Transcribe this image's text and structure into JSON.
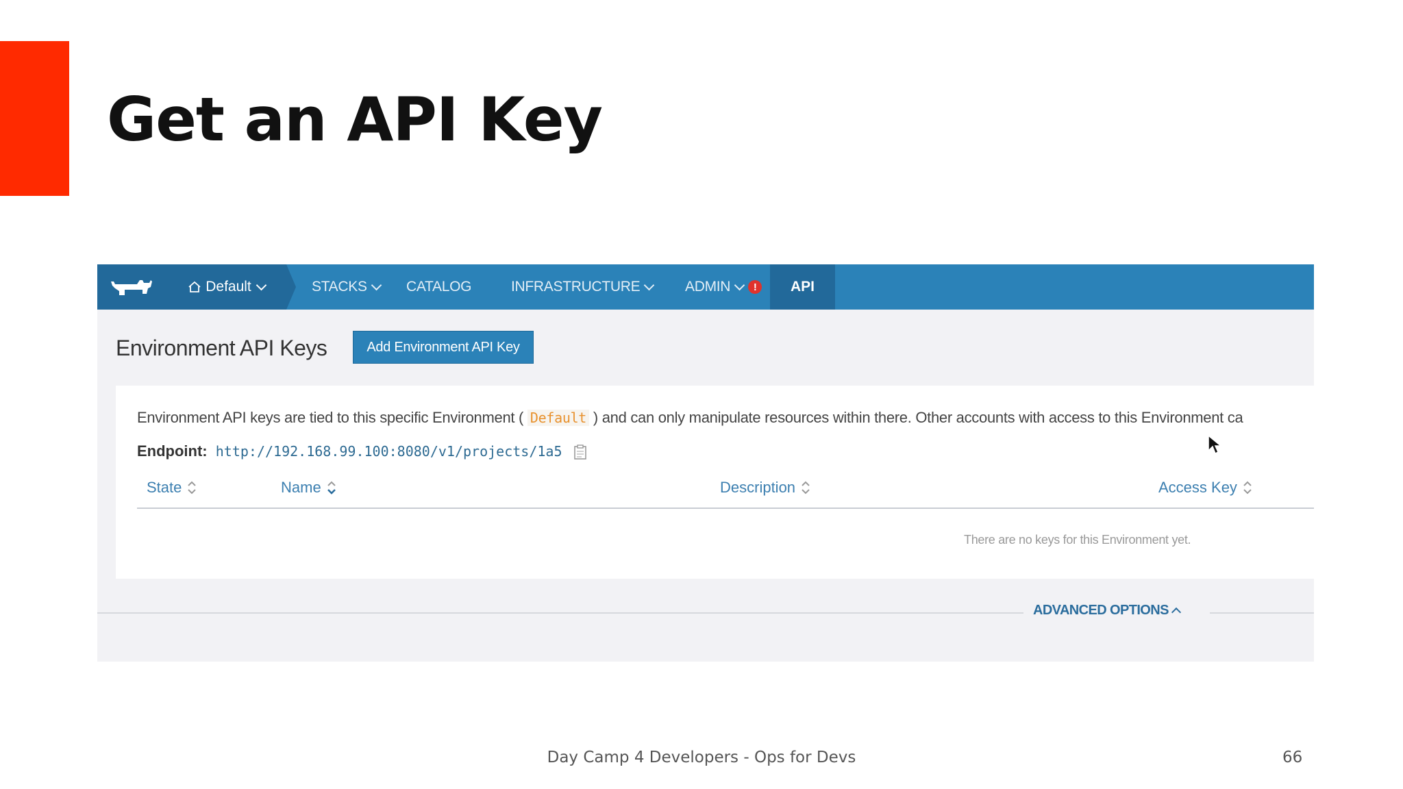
{
  "slide": {
    "title": "Get an API Key",
    "footer": "Day Camp 4 Developers - Ops for Devs",
    "page_number": "66",
    "accent_color": "#ff2a00"
  },
  "app": {
    "nav": {
      "logo_icon": "rancher-cow-logo",
      "environment": "Default",
      "environment_icon": "home-icon",
      "items": [
        {
          "label": "STACKS",
          "has_dropdown": true
        },
        {
          "label": "CATALOG",
          "has_dropdown": false
        },
        {
          "label": "INFRASTRUCTURE",
          "has_dropdown": true
        },
        {
          "label": "ADMIN",
          "has_dropdown": true,
          "alert": "!"
        }
      ],
      "active": "API",
      "bar_color": "#2b82b8",
      "dark_color": "#22699a",
      "alert_color": "#e0332c"
    },
    "page_heading": "Environment API Keys",
    "add_button": "Add Environment API Key",
    "info": {
      "prefix": "Environment API keys are tied to this specific Environment (",
      "env_code": "Default",
      "suffix": ") and can only manipulate resources within there. Other accounts with access to this Environment ca"
    },
    "endpoint": {
      "label": "Endpoint:",
      "url": "http://192.168.99.100:8080/v1/projects/1a5",
      "copy_icon": "clipboard-icon"
    },
    "table": {
      "columns": [
        "State",
        "Name",
        "Description",
        "Access Key"
      ],
      "empty_message": "There are no keys for this Environment yet."
    },
    "advanced_options": "ADVANCED OPTIONS"
  }
}
